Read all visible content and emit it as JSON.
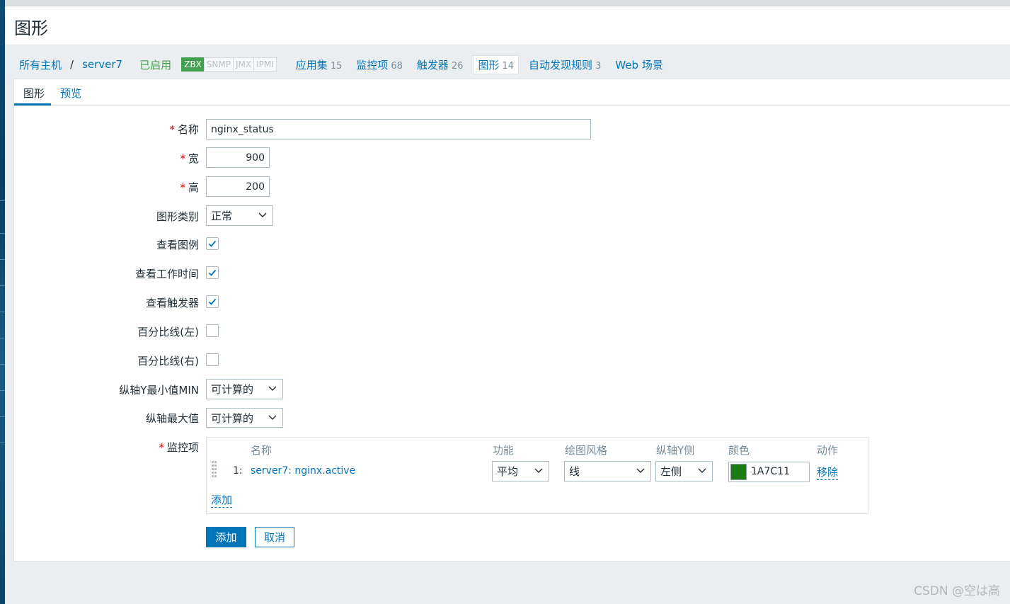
{
  "page_title": "图形",
  "breadcrumb": {
    "all_hosts": "所有主机",
    "separator": "/",
    "host": "server7"
  },
  "host_status": "已启用",
  "availability_badges": [
    {
      "label": "ZBX",
      "active": true
    },
    {
      "label": "SNMP",
      "active": false
    },
    {
      "label": "JMX",
      "active": false
    },
    {
      "label": "IPMI",
      "active": false
    }
  ],
  "host_tabs": [
    {
      "label": "应用集",
      "count": "15"
    },
    {
      "label": "监控项",
      "count": "68"
    },
    {
      "label": "触发器",
      "count": "26"
    },
    {
      "label": "图形",
      "count": "14",
      "active": true
    },
    {
      "label": "自动发现规则",
      "count": "3"
    },
    {
      "label": "Web 场景",
      "count": ""
    }
  ],
  "form_tabs": {
    "graph": "图形",
    "preview": "预览"
  },
  "form": {
    "name_label": "名称",
    "name_value": "nginx_status",
    "width_label": "宽",
    "width_value": "900",
    "height_label": "高",
    "height_value": "200",
    "graph_type_label": "图形类别",
    "graph_type_value": "正常",
    "show_legend_label": "查看图例",
    "show_legend": true,
    "show_working_time_label": "查看工作时间",
    "show_working_time": true,
    "show_triggers_label": "查看触发器",
    "show_triggers": true,
    "percentile_left_label": "百分比线(左)",
    "percentile_left": false,
    "percentile_right_label": "百分比线(右)",
    "percentile_right": false,
    "ymin_label": "纵轴Y最小值MIN",
    "ymin_value": "可计算的",
    "ymax_label": "纵轴最大值",
    "ymax_value": "可计算的",
    "items_label": "监控项"
  },
  "items_table": {
    "headers": {
      "name": "名称",
      "function": "功能",
      "draw_style": "绘图风格",
      "y_axis_side": "纵轴Y侧",
      "color": "颜色",
      "action": "动作"
    },
    "rows": [
      {
        "index": "1:",
        "name": "server7: nginx.active",
        "function": "平均",
        "draw_style": "线",
        "y_axis_side": "左侧",
        "color_hex": "1A7C11",
        "color": "#1A7C11",
        "action": "移除"
      }
    ],
    "add_link": "添加"
  },
  "buttons": {
    "add": "添加",
    "cancel": "取消"
  },
  "watermark": "CSDN @空は高",
  "colors": {
    "accent": "#0275b8",
    "enabled": "#429e47",
    "required": "#d40000"
  }
}
